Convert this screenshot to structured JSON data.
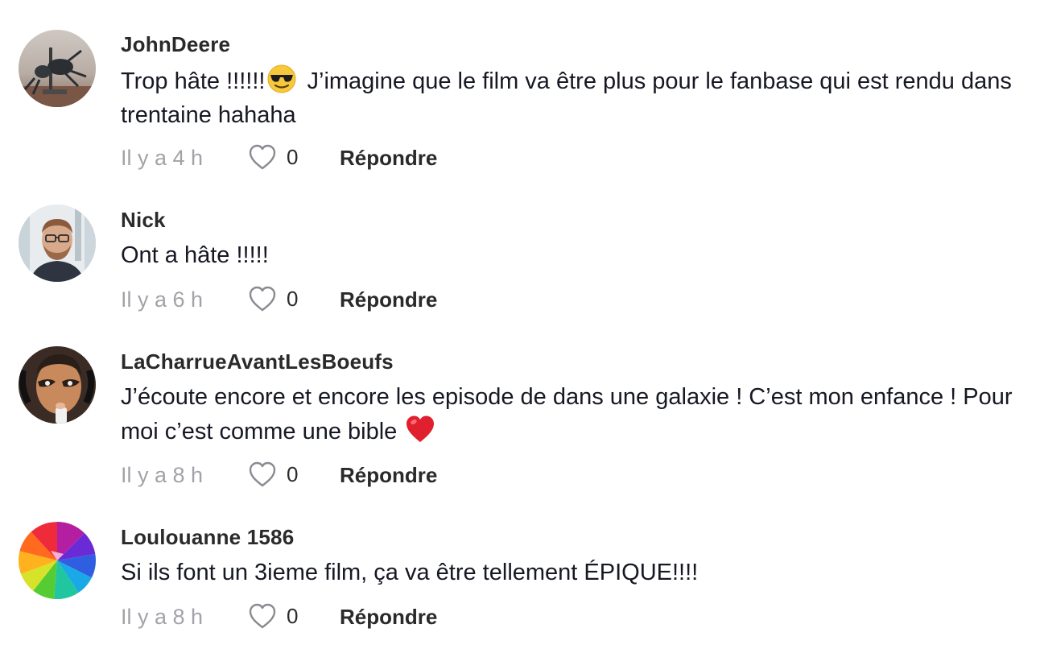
{
  "comments": [
    {
      "username": "JohnDeere",
      "text_before_emoji": "Trop hâte !!!!!!",
      "emoji": "smiling-face-with-sunglasses",
      "text_after_emoji": " J’imagine que le film va être plus pour le fanbase qui est rendu dans trentaine hahaha",
      "time": "Il y a 4 h",
      "likes": "0",
      "reply_label": "Répondre",
      "avatar": "ant-sculpture-photo"
    },
    {
      "username": "Nick",
      "text": "Ont a hâte !!!!!",
      "time": "Il y a 6 h",
      "likes": "0",
      "reply_label": "Répondre",
      "avatar": "man-with-glasses-photo"
    },
    {
      "username": "LaCharrueAvantLesBoeufs",
      "text_before_emoji": "J’écoute encore et encore les episode de dans une galaxie ! C’est mon enfance ! Pour moi c’est comme une bible ",
      "emoji": "red-heart",
      "time": "Il y a 8 h",
      "likes": "0",
      "reply_label": "Répondre",
      "avatar": "man-with-headset-photo"
    },
    {
      "username": "Loulouanne 1586",
      "text": "Si ils font un 3ieme film, ça va être tellement ÉPIQUE!!!!",
      "time": "Il y a 8 h",
      "likes": "0",
      "reply_label": "Répondre",
      "avatar": "rainbow-polygon-art"
    }
  ],
  "colors": {
    "text": "#161823",
    "secondary": "#a2a3a8",
    "heart_emoji": "#e0202e"
  }
}
